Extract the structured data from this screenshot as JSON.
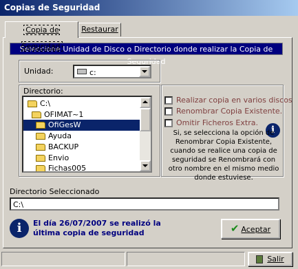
{
  "window": {
    "title": "Copias de Seguridad"
  },
  "tabs": [
    {
      "label": "Copia de Seguridad"
    },
    {
      "label": "Restaurar"
    }
  ],
  "banner": "Seleccione Unidad de Disco o Directorio donde realizar la Copia de Seguridad",
  "unit": {
    "label": "Unidad:",
    "value": "c:"
  },
  "directory": {
    "label": "Directorio:",
    "items": [
      "C:\\",
      "OFIMAT~1",
      "OfiGesW",
      "Ayuda",
      "BACKUP",
      "Envio",
      "Fichas005"
    ],
    "selected": "OfiGesW"
  },
  "options": {
    "items": [
      {
        "label": "Realizar copia en varios discos",
        "checked": false
      },
      {
        "label": "Renombrar Copia Existente.",
        "checked": false
      },
      {
        "label": "Omitir Ficheros Extra.",
        "checked": false
      }
    ],
    "info": "Si, se selecciona la opción de Renombrar Copia Existente, cuando se realice una copia de seguridad se Renombrará con otro nombre en el mismo medio donde estuviese."
  },
  "selected_dir": {
    "label": "Directorio Seleccionado",
    "value": "C:\\"
  },
  "message": {
    "line1": "El día 26/07/2007 se realizó la",
    "line2": "última copia de seguridad"
  },
  "buttons": {
    "accept": "Aceptar",
    "exit": "Salir"
  },
  "colors": {
    "banner": "#00007f",
    "message": "#00007f",
    "selection": "#0a246a"
  },
  "icons": {
    "info": "info-icon",
    "accept": "check-icon",
    "exit": "door-exit-icon",
    "drive": "drive-icon",
    "folder": "folder-icon"
  }
}
